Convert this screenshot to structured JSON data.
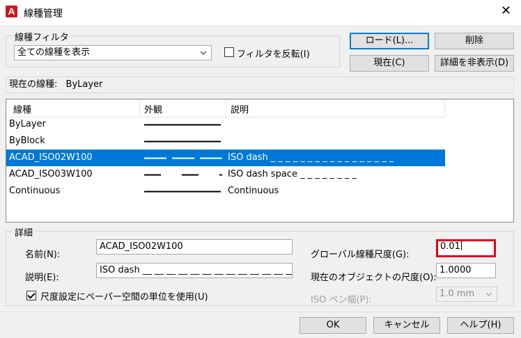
{
  "window": {
    "title": "線種管理",
    "app_icon_letter": "A",
    "close_glyph": "✕"
  },
  "filter": {
    "group_label": "線種フィルタ",
    "selected": "全ての線種を表示",
    "invert_label": "フィルタを反転(I)",
    "invert_checked": false
  },
  "buttons": {
    "load": "ロード(L)...",
    "delete": "削除",
    "current": "現在(C)",
    "hide_details": "詳細を非表示(D)",
    "ok": "OK",
    "cancel": "キャンセル",
    "help": "ヘルプ(H)"
  },
  "current_linetype": {
    "label": "現在の線種:",
    "value": "ByLayer"
  },
  "list": {
    "headers": {
      "linetype": "線種",
      "appearance": "外観",
      "description": "説明"
    },
    "rows": [
      {
        "name": "ByLayer",
        "description": "",
        "pattern": "solid",
        "selected": false
      },
      {
        "name": "ByBlock",
        "description": "",
        "pattern": "solid",
        "selected": false
      },
      {
        "name": "ACAD_ISO02W100",
        "description": "ISO dash _ _ _ _ _ _ _ _ _ _ _ _ _ _ _ _ _",
        "pattern": "dash",
        "selected": true
      },
      {
        "name": "ACAD_ISO03W100",
        "description": "ISO dash space _   _   _   _   _   _   _   _",
        "pattern": "dash-space",
        "selected": false
      },
      {
        "name": "Continuous",
        "description": "Continuous",
        "pattern": "solid",
        "selected": false
      }
    ]
  },
  "details": {
    "group_label": "詳細",
    "name_label": "名前(N):",
    "name_value": "ACAD_ISO02W100",
    "desc_label": "説明(E):",
    "desc_value": "ISO dash __ __ __ __ __ __ __ __ __ __ __ __ __",
    "paper_space_label": "尺度設定にペーパー空間の単位を使用(U)",
    "paper_space_checked": true,
    "global_scale_label": "グローバル線種尺度(G):",
    "global_scale_value": "0.01",
    "object_scale_label": "現在のオブジェクトの尺度(O):",
    "object_scale_value": "1.0000",
    "iso_pen_label": "ISO ペン幅(P):",
    "iso_pen_value": "1.0 mm"
  },
  "colors": {
    "selection": "#0078d7",
    "highlight_border": "#e0001b",
    "app_icon": "#c8161d"
  }
}
